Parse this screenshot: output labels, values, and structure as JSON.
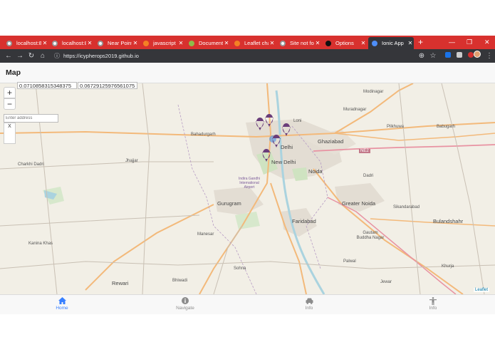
{
  "browser": {
    "tabs": [
      {
        "label": "localhost:8",
        "favicon_color": "#ffffff"
      },
      {
        "label": "localhost:8",
        "favicon_color": "#ffffff"
      },
      {
        "label": "Near Point",
        "favicon_color": "#ffffff"
      },
      {
        "label": "javascript",
        "favicon_color": "#f48024"
      },
      {
        "label": "Documenta",
        "favicon_color": "#8fbc4a"
      },
      {
        "label": "Leaflet chai",
        "favicon_color": "#f48024"
      },
      {
        "label": "Site not fou",
        "favicon_color": "#ffffff"
      },
      {
        "label": "Options",
        "favicon_color": "#111111"
      },
      {
        "label": "Ionic App",
        "favicon_color": "#4e8ef7"
      }
    ],
    "new_tab": "+",
    "window_controls": {
      "minimize": "—",
      "maximize": "❐",
      "close": "✕"
    },
    "url": "https://icypherops2019.github.io"
  },
  "app": {
    "title": "Map",
    "coords": {
      "lat": "0.0710858315348375",
      "lng": "0.06729125976561075"
    },
    "zoom_in": "+",
    "zoom_out": "−",
    "address_placeholder": "Enter address",
    "address_clear": "X",
    "attribution": "Leaflet"
  },
  "map_labels": [
    {
      "text": "Modinagar"
    },
    {
      "text": "Muradnagar"
    },
    {
      "text": "Loni"
    },
    {
      "text": "Pilkhuwa"
    },
    {
      "text": "Babugarh"
    },
    {
      "text": "Bahadurgarh"
    },
    {
      "text": "Ghaziabad"
    },
    {
      "text": "Delhi"
    },
    {
      "text": "New Delhi"
    },
    {
      "text": "Noida"
    },
    {
      "text": "NE2"
    },
    {
      "text": "Dadri"
    },
    {
      "text": "Jhajjar"
    },
    {
      "text": "Charkhi Dadri"
    },
    {
      "text": "Indira Gandhi International Airport"
    },
    {
      "text": "Gurugram"
    },
    {
      "text": "Greater Noida"
    },
    {
      "text": "Sikandarabad"
    },
    {
      "text": "Bulandshahr"
    },
    {
      "text": "Faridabad"
    },
    {
      "text": "Manesar"
    },
    {
      "text": "Gautam Buddha Nagar"
    },
    {
      "text": "Kanina Khas"
    },
    {
      "text": "Palwal"
    },
    {
      "text": "Khurja"
    },
    {
      "text": "Sohna"
    },
    {
      "text": "Rewari"
    },
    {
      "text": "Bhiwadi"
    },
    {
      "text": "Jewar"
    }
  ],
  "tabbar": [
    {
      "label": "Home",
      "icon": "home-icon",
      "active": true
    },
    {
      "label": "Navigate",
      "icon": "info-circle-icon",
      "active": false
    },
    {
      "label": "Info",
      "icon": "car-icon",
      "active": false
    },
    {
      "label": "Info",
      "icon": "accessibility-icon",
      "active": false
    }
  ],
  "colors": {
    "tabstrip": "#d8312e",
    "toolbar": "#35363a",
    "marker": "#6a3d7a",
    "active_tab": "#3880ff",
    "map_bg": "#f2efe6"
  }
}
